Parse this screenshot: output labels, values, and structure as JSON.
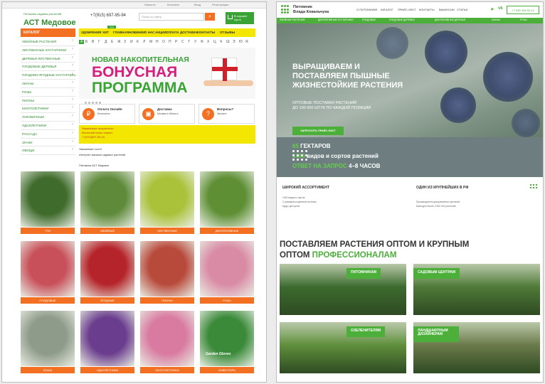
{
  "left": {
    "topbar": [
      "Новости",
      "Контакты",
      "Вход",
      "Регистрация"
    ],
    "logo_small": "Питомник садовых растений",
    "logo_main": "АСТ Медовое",
    "phone": "+7(915) 697-95-94",
    "search_placeholder": "Поиск по сайту",
    "cart": {
      "line1": "В корзине",
      "line2": "пусто"
    },
    "catalog_btn": "КАТАЛОГ",
    "nav": [
      "УДОБРЕНИЯ",
      "ХИТ",
      "ГЛАВНАЯ",
      "НОВИНКИ",
      "О НАС",
      "АКЦИИ",
      "ОПЛАТА",
      "ДОСТАВКА",
      "КОНТАКТЫ",
      "ОТЗЫВЫ"
    ],
    "nav_badge": "new",
    "sidebar": [
      "ХВОЙНЫЕ РАСТЕНИЯ",
      "ЛИСТВЕННЫЕ КУСТАРНИКИ",
      "ДЕРЕВЬЯ ЛИСТВЕННЫЕ",
      "ПЛОДОВЫЕ ДЕРЕВЬЯ",
      "ПЛОДОВО-ЯГОДНЫЕ КУСТАРНИКИ",
      "ЛИАНЫ",
      "РОЗЫ",
      "ПИОНЫ",
      "МНОГОЛЕТНИКИ",
      "ЛУКОВИЧНЫЕ",
      "ОДНОЛЕТНИКИ",
      "РАССАДА",
      "ЗЛАКИ",
      "ОВОЩИ"
    ],
    "alphabet": [
      "А",
      "Б",
      "В",
      "Г",
      "Д",
      "Е",
      "Ж",
      "З",
      "И",
      "К",
      "Л",
      "М",
      "Н",
      "О",
      "П",
      "Р",
      "С",
      "Т",
      "У",
      "Ф",
      "Х",
      "Ц",
      "Ч",
      "Ш",
      "Э",
      "Ю",
      "Я"
    ],
    "alphabet_selected": "А",
    "banner": {
      "line1": "НОВАЯ НАКОПИТЕЛЬНАЯ",
      "line2": "БОНУСНАЯ",
      "line3": "ПРОГРАММА"
    },
    "boxes": [
      {
        "icon": "cart-icon",
        "title": "Оплата Онлайн",
        "text": "Безопасно"
      },
      {
        "icon": "truck-icon",
        "title": "Доставка",
        "text": "Москва и область"
      },
      {
        "icon": "question-icon",
        "title": "Вопросы?",
        "text": "Звоните"
      }
    ],
    "yellow": [
      "Уважаемые покупатели!",
      "Весенний сезон открыт",
      "+7(915)697-95-94"
    ],
    "intro": [
      "Уважаемые гости!",
      "Интернет-магазин садовых растений",
      "Питомник АСТ Медовое"
    ],
    "products": [
      {
        "label": "ТУИ",
        "color": "#3f6b2c"
      },
      {
        "label": "ХВОЙНЫЕ",
        "color": "#5f8a3a"
      },
      {
        "label": "ЛИСТВЕННЫЕ",
        "color": "#a9c23a"
      },
      {
        "label": "ДЕКОРАТИВНЫЕ",
        "color": "#5e8f34"
      },
      {
        "label": "ПЛОДОВЫЕ",
        "color": "#c8505a"
      },
      {
        "label": "ЯГОДНЫЕ",
        "color": "#b5242a"
      },
      {
        "label": "ПИОНЫ",
        "color": "#b84a3c"
      },
      {
        "label": "РОЗЫ",
        "color": "#d98aa5"
      },
      {
        "label": "ЗЛАКИ",
        "color": "#8f9b8a"
      },
      {
        "label": "ОДНОЛЕТНИКИ",
        "color": "#6b3d8e"
      },
      {
        "label": "МНОГОЛЕТНИКИ",
        "color": "#d97aa0"
      },
      {
        "label": "ИНВЕНТАРЬ",
        "color": "#3a8a3a"
      }
    ],
    "gloves_text": "Garden Gloves"
  },
  "right": {
    "logo": [
      "Питомник",
      "Влада Ковальчука"
    ],
    "menu": [
      "О ПИТОМНИКЕ",
      "КАТАЛОГ",
      "ПРАЙС-ЛИСТ",
      "КОНТАКТЫ",
      "ВАКАНСИИ",
      "СТАТЬИ"
    ],
    "phone": "+7 925 434-92-11",
    "subnav": [
      "ХВОЙНЫЕ РАСТЕНИЯ",
      "ДЕКОРАТИВНЫЕ КУСТАРНИКИ",
      "ПЛОДОВЫЕ",
      "ПЛОДОВЫЕ ДЕРЕВЬЯ",
      "ДЕКОРАТИВНЫЕ ДЕРЕВЬЯ",
      "ЛИАНЫ",
      "РОЗЫ"
    ],
    "hero_title": [
      "ВЫРАЩИВАЕМ И",
      "ПОСТАВЛЯЕМ ПЫШНЫЕ",
      "ЖИЗНЕСТОЙКИЕ РАСТЕНИЯ"
    ],
    "hero_sub": [
      "ОПТОВЫЕ ПОСТАВКИ РАСТЕНИЙ",
      "ДО 100 000 ШТУК ПО КАЖДОЙ ПОЗИЦИИ"
    ],
    "cta": "ЗАПРОСИТЬ ПРАЙС-ЛИСТ",
    "stats": [
      {
        "hl": "65",
        "rest": " ГЕКТАРОВ"
      },
      {
        "hl": "1400",
        "rest": " видов и сортов растений"
      },
      {
        "hl": "ОТВЕТ НА ЗАПРОС",
        "rest": " 4–8 ЧАСОВ"
      }
    ],
    "info": [
      {
        "title": "ШИРОКИЙ АССОРТИМЕНТ",
        "lines": [
          "1400 видов и сортов",
          "С размером корневой системы",
          "Будут доступны"
        ]
      },
      {
        "title": "ОДИН ИЗ КРУПНЕЙШИХ В РФ",
        "lines": [
          "Производитель декоративных растений",
          "Ежегодно более 2 500 000 растений"
        ]
      }
    ],
    "section_title": [
      "ПОСТАВЛЯЕМ РАСТЕНИЯ ОПТОМ И КРУПНЫМ",
      "ОПТОМ "
    ],
    "section_title_hl": "ПРОФЕССИОНАЛАМ",
    "cards": [
      {
        "label": "ПИТОМНИКАМ",
        "color": "#3c6b2e"
      },
      {
        "label": "САДОВЫМ ЦЕНТРАМ",
        "color": "#4f7a38"
      },
      {
        "label": "ОЗЕЛЕНИТЕЛЯМ",
        "color": "#5f8f3c"
      },
      {
        "label": "ЛАНДШАФТНЫМ ДИЗАЙНЕРАМ",
        "color": "#6b7a4a"
      }
    ]
  }
}
